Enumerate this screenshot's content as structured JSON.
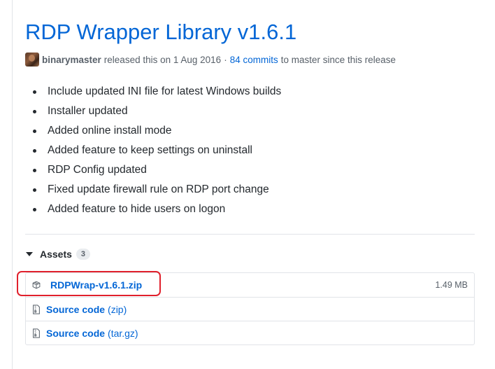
{
  "release": {
    "title": "RDP Wrapper Library v1.6.1",
    "author": "binarymaster",
    "released_text": "released this on 1 Aug 2016",
    "separator": "·",
    "commits_link": "84 commits",
    "commits_suffix": "to master since this release"
  },
  "notes": [
    "Include updated INI file for latest Windows builds",
    "Installer updated",
    "Added online install mode",
    "Added feature to keep settings on uninstall",
    "RDP Config updated",
    "Fixed update firewall rule on RDP port change",
    "Added feature to hide users on logon"
  ],
  "assets": {
    "label": "Assets",
    "count": "3",
    "items": [
      {
        "name": "RDPWrap-v1.6.1.zip",
        "suffix": "",
        "size": "1.49 MB",
        "icon": "package-icon"
      },
      {
        "name": "Source code",
        "suffix": "(zip)",
        "size": "",
        "icon": "file-zip-icon"
      },
      {
        "name": "Source code",
        "suffix": "(tar.gz)",
        "size": "",
        "icon": "file-zip-icon"
      }
    ]
  },
  "colors": {
    "link": "#0366d6",
    "muted": "#586069",
    "highlight": "#e0202c"
  }
}
